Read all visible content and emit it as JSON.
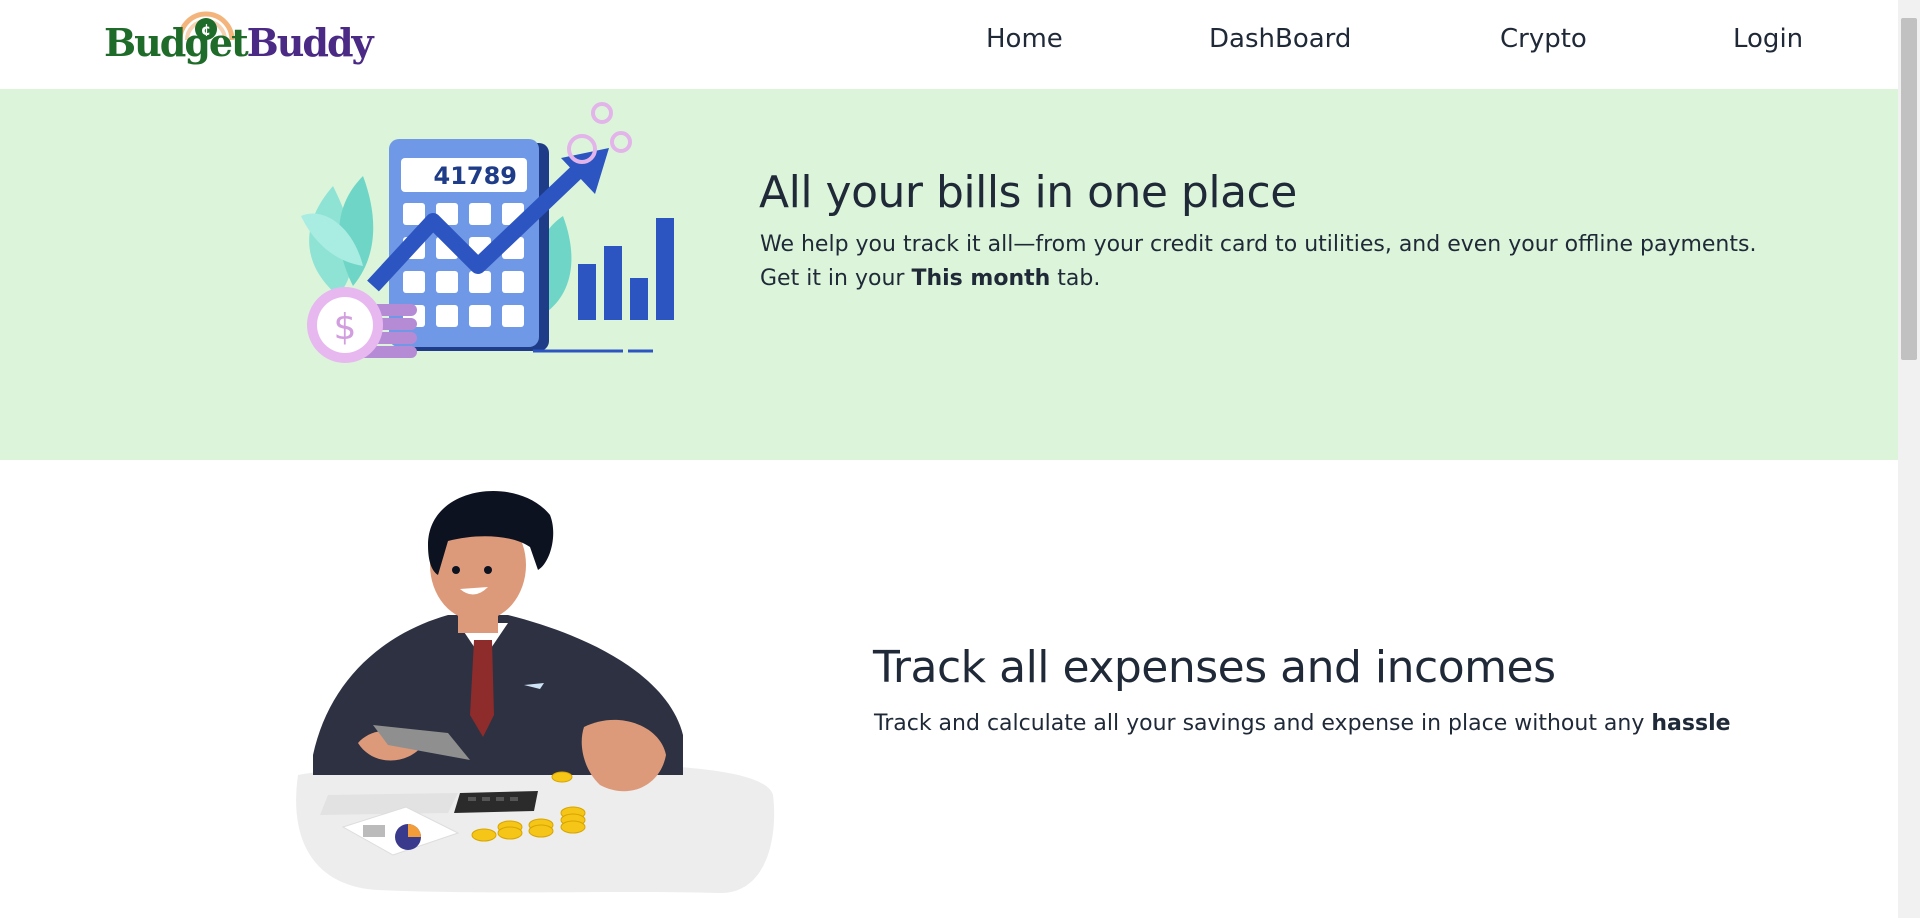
{
  "brand": {
    "logo_part1": "Budget",
    "logo_part2": "Buddy"
  },
  "nav": {
    "home": "Home",
    "dashboard": "DashBoard",
    "crypto": "Crypto",
    "login": "Login"
  },
  "hero": {
    "title": "All your bills in one place",
    "line1": "We help you track it all—from your credit card to utilities, and even your offline payments.",
    "line2_prefix": "Get it in your ",
    "line2_bold": "This month",
    "line2_suffix": " tab.",
    "calculator_display": "41789"
  },
  "track": {
    "title": "Track all expenses and incomes",
    "body_prefix": "Track and calculate all your savings and expense in place without any ",
    "body_bold": "hassle"
  },
  "colors": {
    "hero_bg": "#dcf5da",
    "logo_green": "#1f6b2a",
    "logo_purple": "#4b2a86",
    "text_dark": "#1f2937"
  },
  "icons": {
    "hero_illustration": "calculator-growth-chart-illustration",
    "track_illustration": "businessman-counting-coins-illustration"
  }
}
